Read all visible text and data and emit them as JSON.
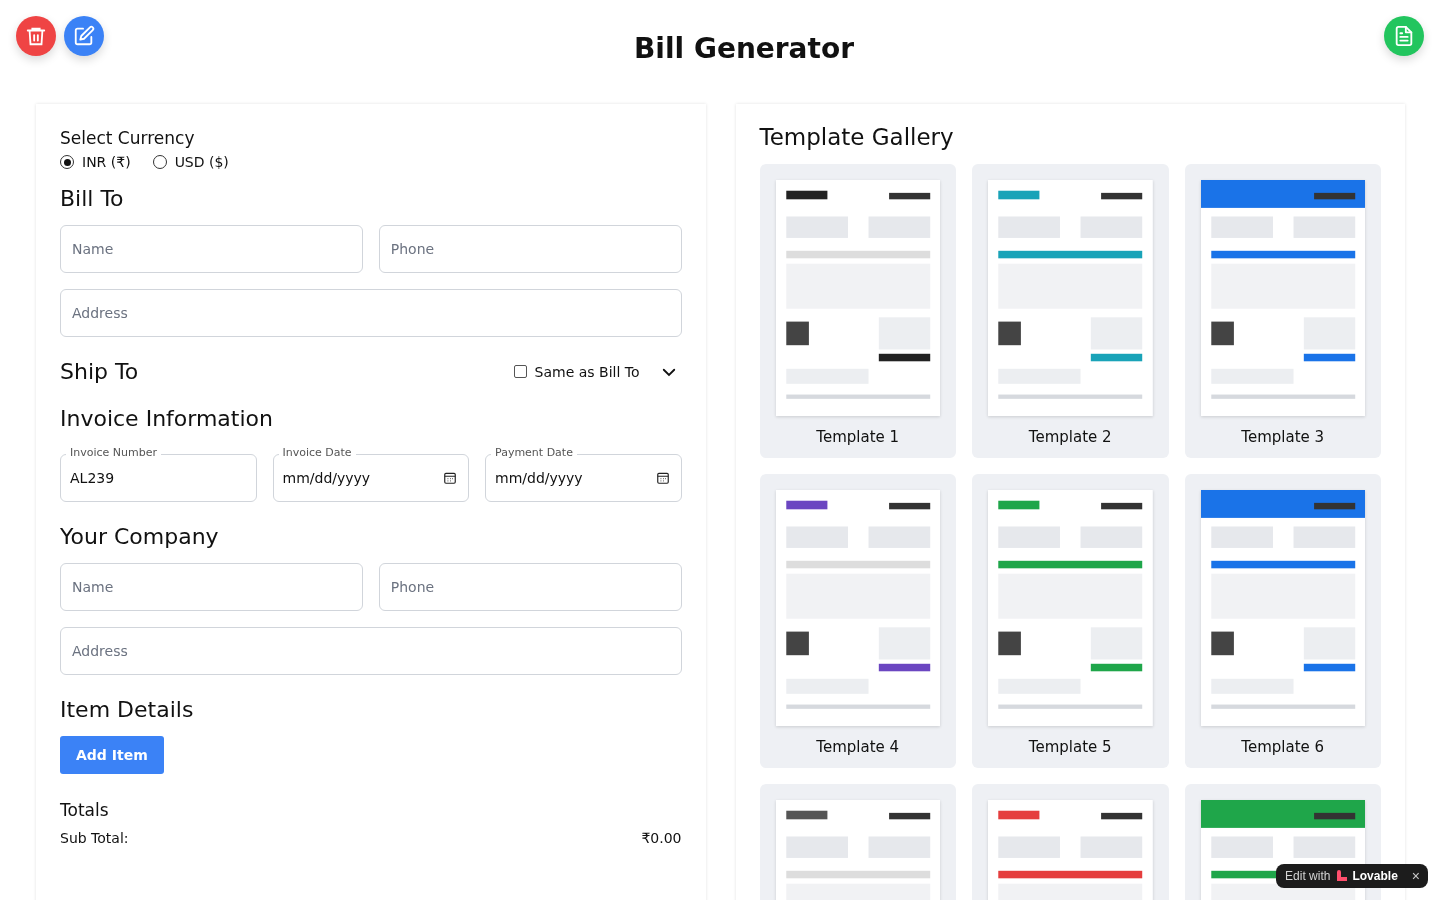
{
  "header": {
    "title": "Bill Generator"
  },
  "currency": {
    "label": "Select Currency",
    "options": [
      {
        "label": "INR (₹)",
        "selected": true
      },
      {
        "label": "USD ($)",
        "selected": false
      }
    ]
  },
  "bill_to": {
    "title": "Bill To",
    "name_placeholder": "Name",
    "phone_placeholder": "Phone",
    "address_placeholder": "Address"
  },
  "ship_to": {
    "title": "Ship To",
    "same_as_label": "Same as Bill To",
    "same_as_checked": false
  },
  "invoice_info": {
    "title": "Invoice Information",
    "fields": [
      {
        "label": "Invoice Number",
        "value": "AL239",
        "kind": "text"
      },
      {
        "label": "Invoice Date",
        "value": "mm/dd/yyyy",
        "kind": "date"
      },
      {
        "label": "Payment Date",
        "value": "mm/dd/yyyy",
        "kind": "date"
      }
    ]
  },
  "your_company": {
    "title": "Your Company",
    "name_placeholder": "Name",
    "phone_placeholder": "Phone",
    "address_placeholder": "Address"
  },
  "item_details": {
    "title": "Item Details",
    "add_button": "Add Item"
  },
  "totals": {
    "title": "Totals",
    "rows": [
      {
        "label": "Sub Total:",
        "value": "₹0.00"
      }
    ]
  },
  "gallery": {
    "title": "Template Gallery",
    "templates": [
      {
        "label": "Template 1",
        "kind": "picture"
      },
      {
        "label": "Template 2",
        "kind": "picture"
      },
      {
        "label": "Template 3",
        "kind": "picture"
      },
      {
        "label": "Template 4",
        "kind": "picture"
      },
      {
        "label": "Template 5",
        "kind": "picture"
      },
      {
        "label": "Template 6",
        "kind": "picture"
      },
      {
        "kind": "picture"
      },
      {
        "kind": "picture"
      },
      {
        "kind": "picture"
      }
    ]
  },
  "badge": {
    "prefix": "Edit with",
    "brand": "Lovable",
    "close": "×"
  }
}
